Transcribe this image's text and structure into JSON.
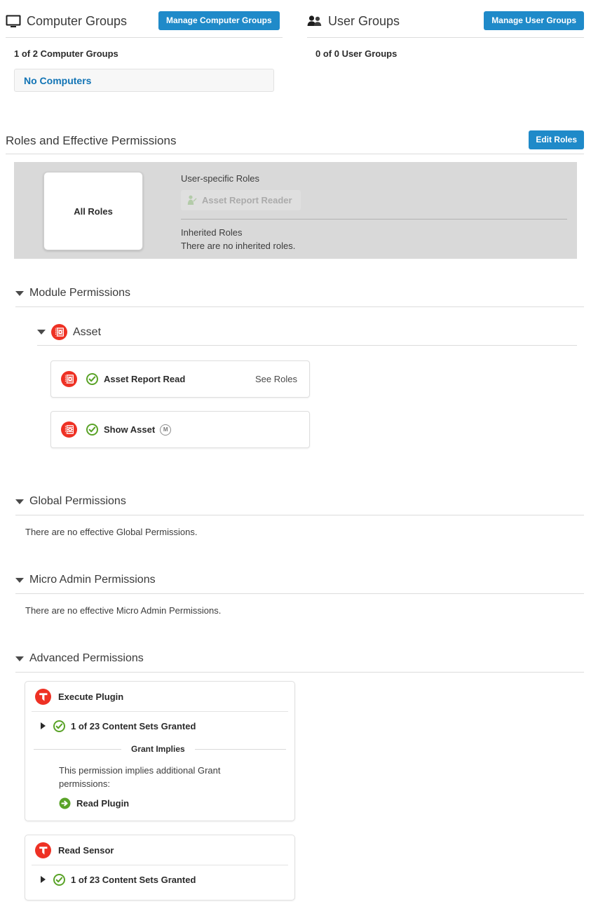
{
  "colors": {
    "accent_blue": "#1f8ac9",
    "link_blue": "#1274b5",
    "module_red": "#ee3124",
    "grant_green": "#5aa328",
    "panel_grey": "#d9d9d9"
  },
  "computer_groups": {
    "icon": "monitor-icon",
    "title": "Computer Groups",
    "manage_button": "Manage Computer Groups",
    "count_label": "1 of 2 Computer Groups",
    "items": [
      {
        "label": "No Computers"
      }
    ]
  },
  "user_groups": {
    "icon": "users-icon",
    "title": "User Groups",
    "manage_button": "Manage User Groups",
    "count_label": "0 of 0 User Groups",
    "items": []
  },
  "roles_section": {
    "title": "Roles and Effective Permissions",
    "edit_button": "Edit Roles",
    "all_roles_card": "All Roles",
    "user_specific_label": "User-specific Roles",
    "user_specific_roles": [
      {
        "label": "Asset Report Reader",
        "icon": "user-edit-icon"
      }
    ],
    "inherited_label": "Inherited Roles",
    "inherited_empty": "There are no inherited roles."
  },
  "module_permissions": {
    "title": "Module Permissions",
    "groups": [
      {
        "name": "Asset",
        "icon": "asset-module-icon",
        "permissions": [
          {
            "label": "Asset Report Read",
            "status_icon": "check-circle-icon",
            "module_icon": "asset-module-icon",
            "action": "See Roles",
            "badge": ""
          },
          {
            "label": "Show Asset",
            "status_icon": "check-circle-icon",
            "module_icon": "asset-module-icon",
            "action": "",
            "badge": "M"
          }
        ]
      }
    ]
  },
  "global_permissions": {
    "title": "Global Permissions",
    "empty": "There are no effective Global Permissions."
  },
  "micro_admin_permissions": {
    "title": "Micro Admin Permissions",
    "empty": "There are no effective Micro Admin Permissions."
  },
  "advanced_permissions": {
    "title": "Advanced Permissions",
    "cards": [
      {
        "name": "Execute Plugin",
        "icon": "tanium-logo-icon",
        "content_sets": "1 of 23 Content Sets Granted",
        "status_icon": "check-circle-icon",
        "expander_icon": "caret-right-icon",
        "grant_implies": {
          "heading": "Grant Implies",
          "body": "This permission implies additional Grant permissions:",
          "items": [
            {
              "label": "Read Plugin",
              "icon": "arrow-circle-right-icon"
            }
          ]
        }
      },
      {
        "name": "Read Sensor",
        "icon": "tanium-logo-icon",
        "content_sets": "1 of 23 Content Sets Granted",
        "status_icon": "check-circle-icon",
        "expander_icon": "caret-right-icon",
        "grant_implies": null
      }
    ]
  }
}
